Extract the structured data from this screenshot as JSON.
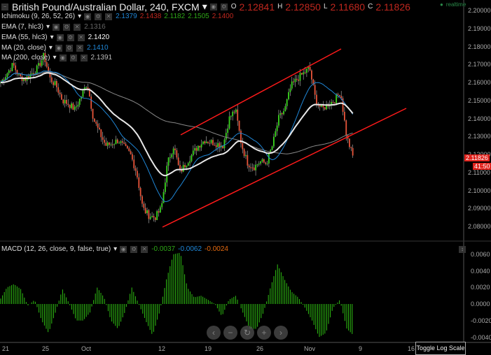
{
  "header": {
    "title": "British Pound/Australian Dollar, 240, FXCM",
    "ohlc": {
      "o_label": "O",
      "o": "2.12841",
      "h_label": "H",
      "h": "2.12850",
      "l_label": "L",
      "l": "2.11680",
      "c_label": "C",
      "c": "2.11826"
    },
    "realtime": "realtime"
  },
  "indicators": [
    {
      "name": "Ichimoku (9, 26, 52, 26)",
      "values": [
        "2.1379",
        "2.1438",
        "2.1182",
        "2.1505",
        "2.1400"
      ]
    },
    {
      "name": "EMA (7, hlc3)",
      "values": [
        "2.1316"
      ]
    },
    {
      "name": "EMA (55, hlc3)",
      "values": [
        "2.1420"
      ]
    },
    {
      "name": "MA (20, close)",
      "values": [
        "2.1410"
      ]
    },
    {
      "name": "MA (200, close)",
      "values": [
        "2.1391"
      ]
    }
  ],
  "price_axis": [
    "2.20000",
    "2.19000",
    "2.18000",
    "2.17000",
    "2.16000",
    "2.15000",
    "2.14000",
    "2.13000",
    "2.12000",
    "2.11000",
    "2.10000",
    "2.09000",
    "2.08000"
  ],
  "current_price": "2.11826",
  "countdown": "41:50",
  "macd": {
    "name": "MACD (12, 26, close, 9, false, true)",
    "values": [
      "-0.0037",
      "-0.0062",
      "-0.0024"
    ],
    "axis": [
      "0.0060",
      "0.0040",
      "0.0020",
      "0.0000",
      "-0.0020",
      "-0.0040"
    ]
  },
  "time_axis": [
    "21",
    "25",
    "Oct",
    "12",
    "19",
    "26",
    "Nov",
    "9",
    "16"
  ],
  "nav": {
    "back": "‹",
    "zoom_out": "−",
    "reset": "↻",
    "zoom_in": "+",
    "forward": "›"
  },
  "toggle_log": "Toggle Log Scale",
  "colors": {
    "up": "#3ad61e",
    "down": "#e8553a",
    "channel": "#ff1a1a",
    "hist": "#2fbf12"
  },
  "chart_data": {
    "type": "candlestick",
    "price_path": [
      2.16,
      2.165,
      2.17,
      2.163,
      2.162,
      2.165,
      2.168,
      2.175,
      2.162,
      2.158,
      2.15,
      2.148,
      2.145,
      2.152,
      2.16,
      2.14,
      2.132,
      2.125,
      2.126,
      2.128,
      2.124,
      2.12,
      2.11,
      2.09,
      2.086,
      2.085,
      2.09,
      2.115,
      2.125,
      2.11,
      2.115,
      2.12,
      2.125,
      2.128,
      2.127,
      2.126,
      2.125,
      2.14,
      2.145,
      2.125,
      2.115,
      2.113,
      2.116,
      2.115,
      2.125,
      2.14,
      2.145,
      2.158,
      2.162,
      2.165,
      2.168,
      2.15,
      2.145,
      2.148,
      2.15,
      2.155,
      2.13,
      2.119
    ],
    "macd_hist": [
      0.0005,
      0.002,
      0.0024,
      0.0018,
      -0.0002,
      0.0005,
      -0.002,
      -0.0035,
      -0.001,
      0.0018,
      0.0,
      -0.002,
      -0.002,
      -0.001,
      0.002,
      0.0008,
      -0.002,
      -0.003,
      -0.001,
      0.002,
      0.0,
      -0.002,
      -0.0038,
      -0.001,
      0.003,
      0.006,
      0.0062,
      0.002,
      0.0008,
      0.001,
      0.0005,
      0.0,
      -0.0015,
      0.0005,
      0.001,
      -0.001,
      -0.003,
      -0.003,
      -0.001,
      0.002,
      0.0048,
      0.003,
      0.0015,
      0.0008,
      -0.0005,
      -0.002,
      -0.004,
      -0.0035,
      -0.0005,
      0.0005,
      -0.003,
      -0.0038
    ],
    "ylim": [
      2.08,
      2.2
    ],
    "macd_ylim": [
      -0.004,
      0.006
    ]
  }
}
